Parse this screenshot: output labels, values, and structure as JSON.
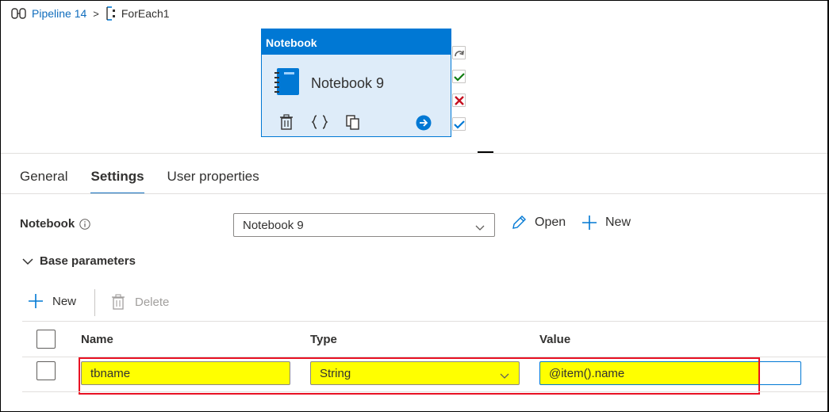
{
  "breadcrumb": {
    "pipeline": "Pipeline 14",
    "separator": ">",
    "current": "ForEach1"
  },
  "activity": {
    "header": "Notebook",
    "name": "Notebook 9",
    "actions": [
      "delete-icon",
      "code-braces-icon",
      "copy-icon",
      "go-arrow-icon"
    ],
    "ports": [
      "skip-port",
      "success-port",
      "failure-port",
      "completion-port"
    ]
  },
  "tabs": [
    {
      "label": "General",
      "active": false
    },
    {
      "label": "Settings",
      "active": true
    },
    {
      "label": "User properties",
      "active": false
    }
  ],
  "settings": {
    "notebook_label": "Notebook",
    "notebook_value": "Notebook 9",
    "open_label": "Open",
    "new_label": "New",
    "base_params_label": "Base parameters"
  },
  "toolbar": {
    "new_label": "New",
    "delete_label": "Delete"
  },
  "grid": {
    "columns": [
      "Name",
      "Type",
      "Value"
    ],
    "rows": [
      {
        "name": "tbname",
        "type": "String",
        "value": "@item().name"
      }
    ]
  },
  "colors": {
    "accent": "#0078d4",
    "link": "#0f6cbd",
    "highlight_fill": "#ffff00",
    "highlight_border": "#e81123"
  }
}
